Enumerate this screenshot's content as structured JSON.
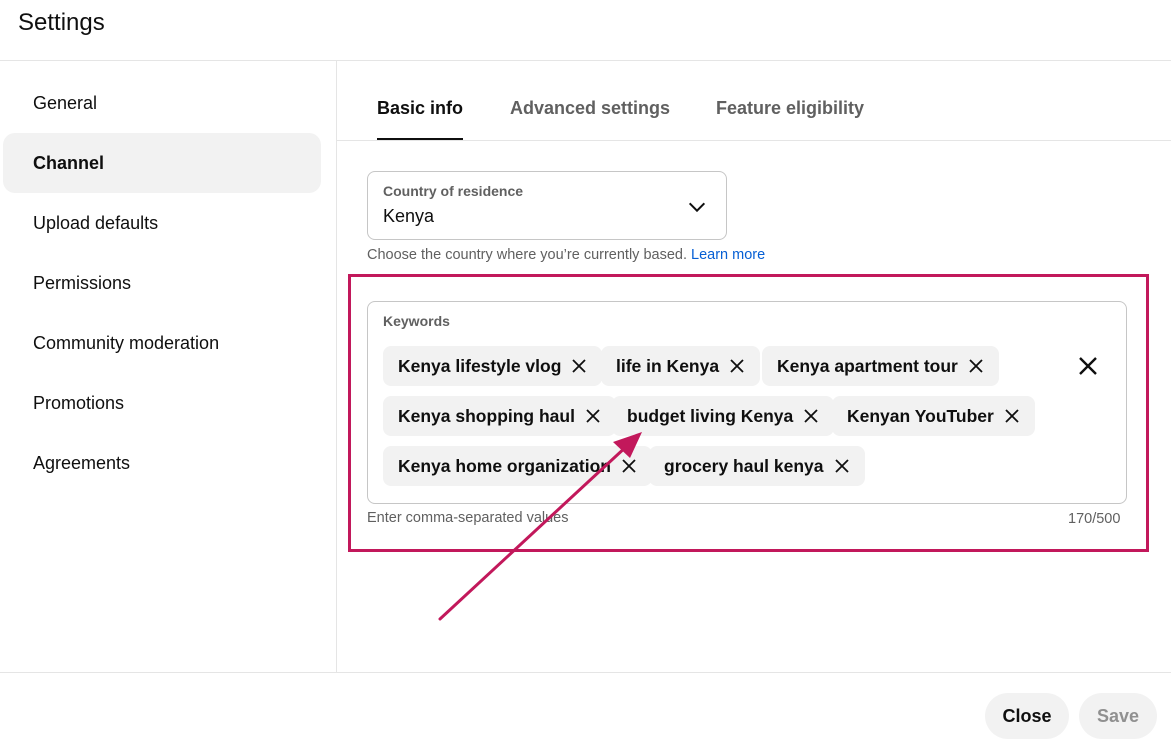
{
  "header": {
    "title": "Settings"
  },
  "sidebar": {
    "items": [
      {
        "label": "General",
        "active": false
      },
      {
        "label": "Channel",
        "active": true
      },
      {
        "label": "Upload defaults",
        "active": false
      },
      {
        "label": "Permissions",
        "active": false
      },
      {
        "label": "Community moderation",
        "active": false
      },
      {
        "label": "Promotions",
        "active": false
      },
      {
        "label": "Agreements",
        "active": false
      }
    ]
  },
  "tabs": [
    {
      "label": "Basic info",
      "active": true
    },
    {
      "label": "Advanced settings",
      "active": false
    },
    {
      "label": "Feature eligibility",
      "active": false
    }
  ],
  "country": {
    "label": "Country of residence",
    "value": "Kenya",
    "helper": "Choose the country where you’re currently based.",
    "learn_more": "Learn more"
  },
  "keywords": {
    "label": "Keywords",
    "chips": [
      "Kenya lifestyle vlog",
      "life in Kenya",
      "Kenya apartment tour",
      "Kenya shopping haul",
      "budget living Kenya",
      "Kenyan YouTuber",
      "Kenya home organization",
      "grocery haul kenya"
    ],
    "hint": "Enter comma-separated values",
    "count": "170/500"
  },
  "footer": {
    "close_label": "Close",
    "save_label": "Save"
  },
  "colors": {
    "annotation": "#c2185b",
    "link": "#065fd4",
    "chip_bg": "#f2f2f2"
  },
  "icons": {
    "chip_remove": "close-icon",
    "dropdown": "chevron-down-icon",
    "clear_all": "close-icon"
  }
}
